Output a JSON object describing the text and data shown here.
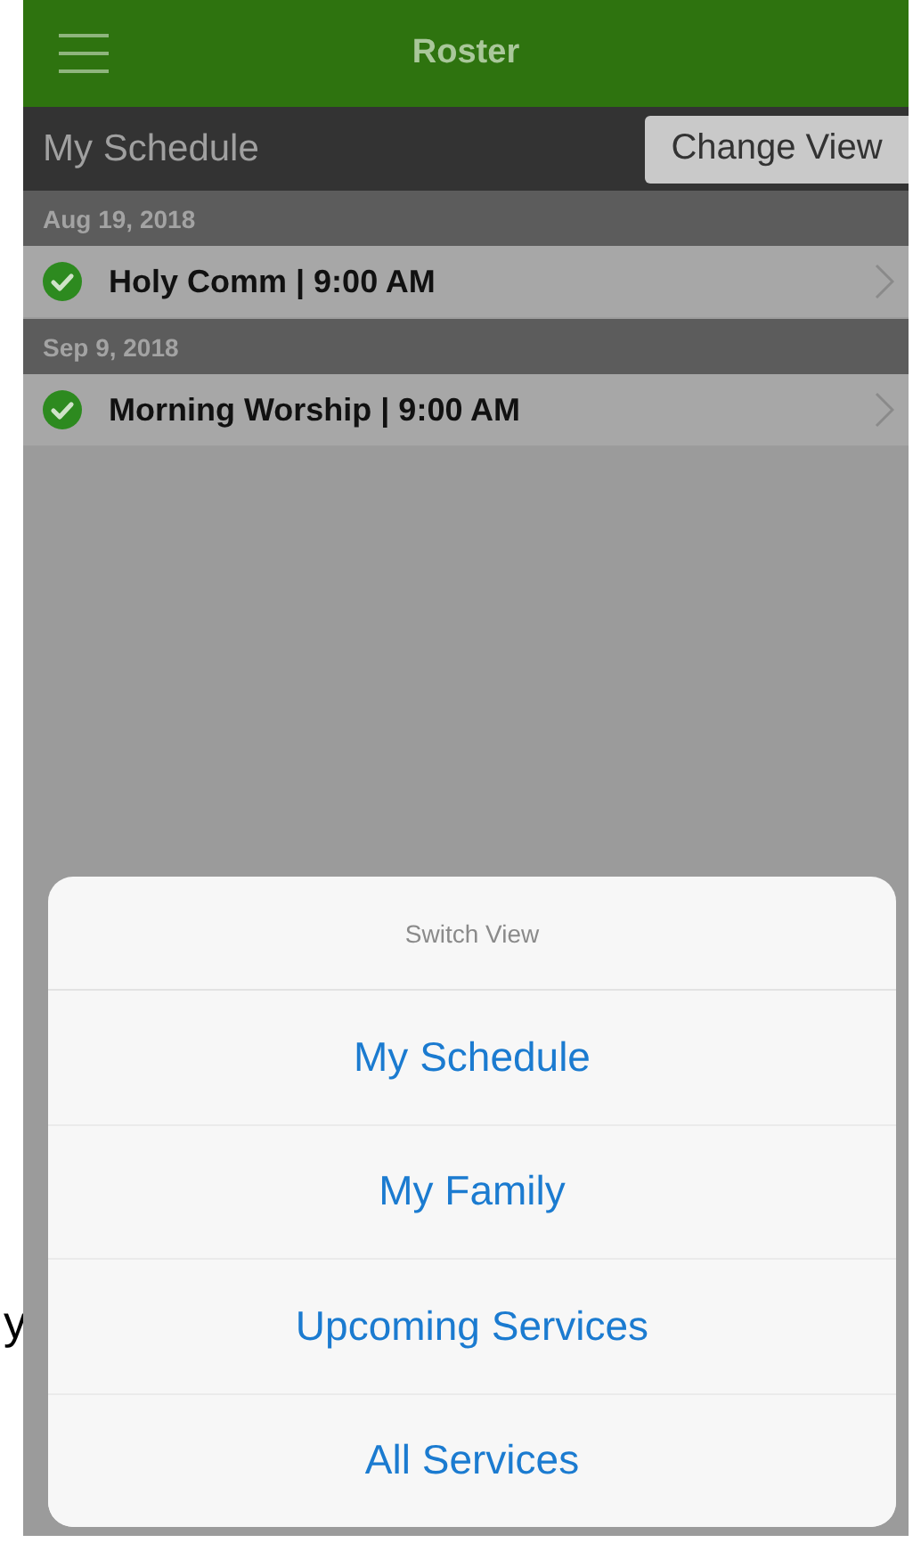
{
  "nav_bar": {
    "title": "Roster"
  },
  "toolbar": {
    "title": "My Schedule",
    "button": "Change View"
  },
  "schedule": [
    {
      "date": "Aug 19, 2018",
      "items": [
        {
          "title": "Holy Comm | 9:00 AM",
          "confirmed": true
        }
      ]
    },
    {
      "date": "Sep 9, 2018",
      "items": [
        {
          "title": "Morning Worship | 9:00 AM",
          "confirmed": true
        }
      ]
    }
  ],
  "action_sheet": {
    "title": "Switch View",
    "options": [
      "My Schedule",
      "My Family",
      "Upcoming Services",
      "All Services"
    ]
  },
  "margin_text": "y"
}
